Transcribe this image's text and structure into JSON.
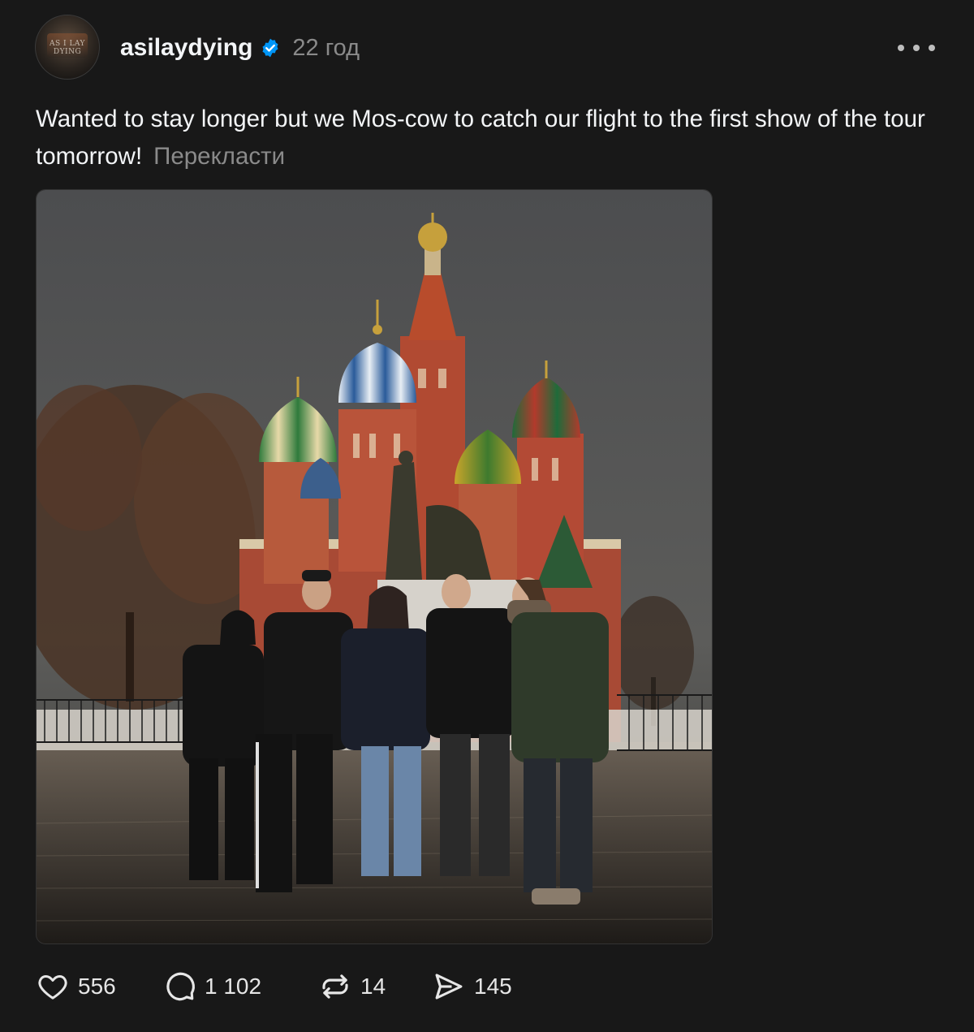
{
  "post": {
    "username": "asilaydying",
    "timestamp": "22 год",
    "avatar_logo_text": "AS I LAY DYING",
    "caption": "Wanted to stay longer but we Mos-cow to catch our flight to the first show of the tour tomorrow!",
    "translate_label": "Перекласти"
  },
  "actions": {
    "likes": "556",
    "replies": "1 102",
    "reposts": "14",
    "shares": "145"
  },
  "icons": {
    "verified": "verified-badge-icon",
    "more": "more-options-icon",
    "like": "heart-icon",
    "reply": "speech-bubble-icon",
    "repost": "repost-arrows-icon",
    "share": "send-paper-plane-icon"
  },
  "colors": {
    "background": "#181818",
    "text": "#f3f5f7",
    "muted": "#8a8a8a",
    "verified": "#0095f6"
  }
}
